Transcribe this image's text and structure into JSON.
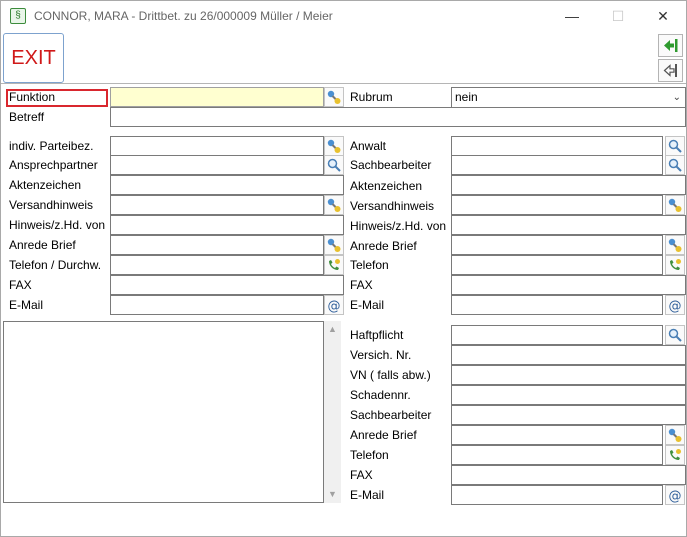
{
  "window": {
    "app_icon": "§",
    "title": "CONNOR, MARA - Drittbet. zu 26/000009 Müller / Meier",
    "minimize": "—",
    "maximize": "☐",
    "close": "✕"
  },
  "toolbar": {
    "exit_label": "EXIT"
  },
  "top": {
    "funktion_label": "Funktion",
    "funktion_value": "",
    "rubrum_label": "Rubrum",
    "rubrum_value": "nein",
    "betreff_label": "Betreff",
    "betreff_value": ""
  },
  "left": {
    "indiv_parteibez": "indiv. Parteibez.",
    "ansprechpartner": "Ansprechpartner",
    "aktenzeichen": "Aktenzeichen",
    "versandhinweis": "Versandhinweis",
    "hinweis": "Hinweis/z.Hd. von",
    "anrede_brief": "Anrede Brief",
    "telefon": "Telefon / Durchw.",
    "fax": "FAX",
    "email": "E-Mail"
  },
  "right": {
    "anwalt": "Anwalt",
    "sachbearbeiter": "Sachbearbeiter",
    "aktenzeichen": "Aktenzeichen",
    "versandhinweis": "Versandhinweis",
    "hinweis": "Hinweis/z.Hd. von",
    "anrede_brief": "Anrede Brief",
    "telefon": "Telefon",
    "fax": "FAX",
    "email": "E-Mail"
  },
  "insurance": {
    "haftpflicht": "Haftpflicht",
    "versich_nr": "Versich. Nr.",
    "vn": "VN ( falls abw.)",
    "schadennr": "Schadennr.",
    "sachbearbeiter": "Sachbearbeiter",
    "anrede_brief": "Anrede Brief",
    "telefon": "Telefon",
    "fax": "FAX",
    "email": "E-Mail"
  },
  "colors": {
    "exit_text": "#d01919",
    "focus_border": "#d9272e",
    "yellow_field": "#ffffd0",
    "nav_green": "#2e9a2e"
  }
}
